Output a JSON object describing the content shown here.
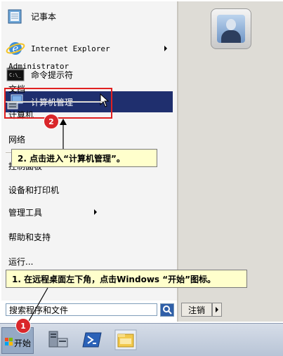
{
  "left_menu": {
    "items": [
      {
        "label": "记事本",
        "icon": "notepad-icon"
      },
      {
        "label": "Internet Explorer",
        "icon": "internet-explorer-icon",
        "submenu": true
      },
      {
        "label": "命令提示符",
        "icon": "command-prompt-icon"
      },
      {
        "label": "计算机管理",
        "icon": "computer-management-icon",
        "selected": true
      }
    ]
  },
  "right_menu": {
    "user": "Administrator",
    "items": [
      {
        "label": "文档"
      },
      {
        "label": "计算机"
      },
      {
        "label": "网络"
      },
      {
        "label": "控制面板"
      },
      {
        "label": "设备和打印机"
      },
      {
        "label": "管理工具",
        "submenu": true
      },
      {
        "label": "帮助和支持"
      },
      {
        "label": "运行..."
      }
    ]
  },
  "search": {
    "placeholder": "搜索程序和文件"
  },
  "logoff": {
    "label": "注销"
  },
  "taskbar": {
    "start_label": "开始"
  },
  "annotations": {
    "callout1": "1. 在远程桌面左下角，点击Windows “开始”图标。",
    "callout2": "2. 点击进入“计算机管理”。",
    "badge1": "1",
    "badge2": "2"
  },
  "colors": {
    "selection": "#1f2f6e",
    "callout_bg": "#ffffcc",
    "badge_red": "#d9262a",
    "highlight_border": "#e02020"
  }
}
